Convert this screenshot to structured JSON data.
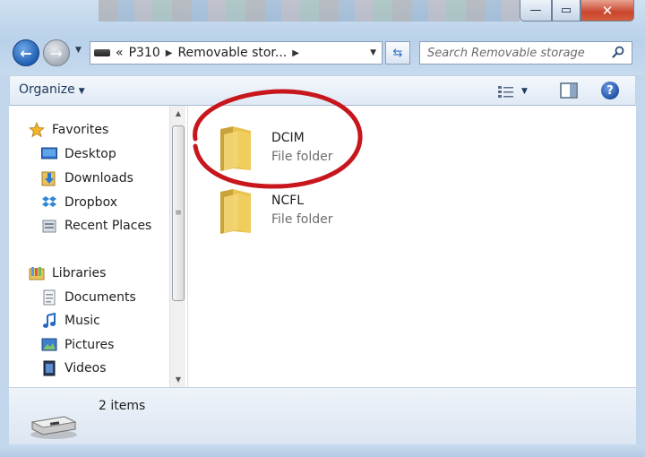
{
  "window": {
    "minimize_glyph": "—",
    "maximize_glyph": "▭",
    "close_glyph": "✕"
  },
  "nav": {
    "back_glyph": "←",
    "forward_glyph": "→",
    "recent_glyph": "▼"
  },
  "address": {
    "overflow_glyph": "«",
    "segments": [
      "P310",
      "Removable stor..."
    ],
    "separator_glyph": "▶",
    "dropdown_glyph": "▼",
    "refresh_glyph": "⇆"
  },
  "search": {
    "placeholder": "Search Removable storage"
  },
  "toolbar": {
    "organize_label": "Organize",
    "caret_glyph": "▼",
    "help_glyph": "?"
  },
  "sidebar": {
    "favorites_label": "Favorites",
    "favorites": [
      "Desktop",
      "Downloads",
      "Dropbox",
      "Recent Places"
    ],
    "libraries_label": "Libraries",
    "libraries": [
      "Documents",
      "Music",
      "Pictures",
      "Videos"
    ],
    "scroll_up_glyph": "▲",
    "scroll_down_glyph": "▼",
    "thumb_grip_glyph": "≡"
  },
  "files": [
    {
      "name": "DCIM",
      "type": "File folder"
    },
    {
      "name": "NCFL",
      "type": "File folder"
    }
  ],
  "status": {
    "item_count": "2 items"
  },
  "colors": {
    "highlight_ellipse": "#c8161d",
    "folder": "#e9c350"
  }
}
